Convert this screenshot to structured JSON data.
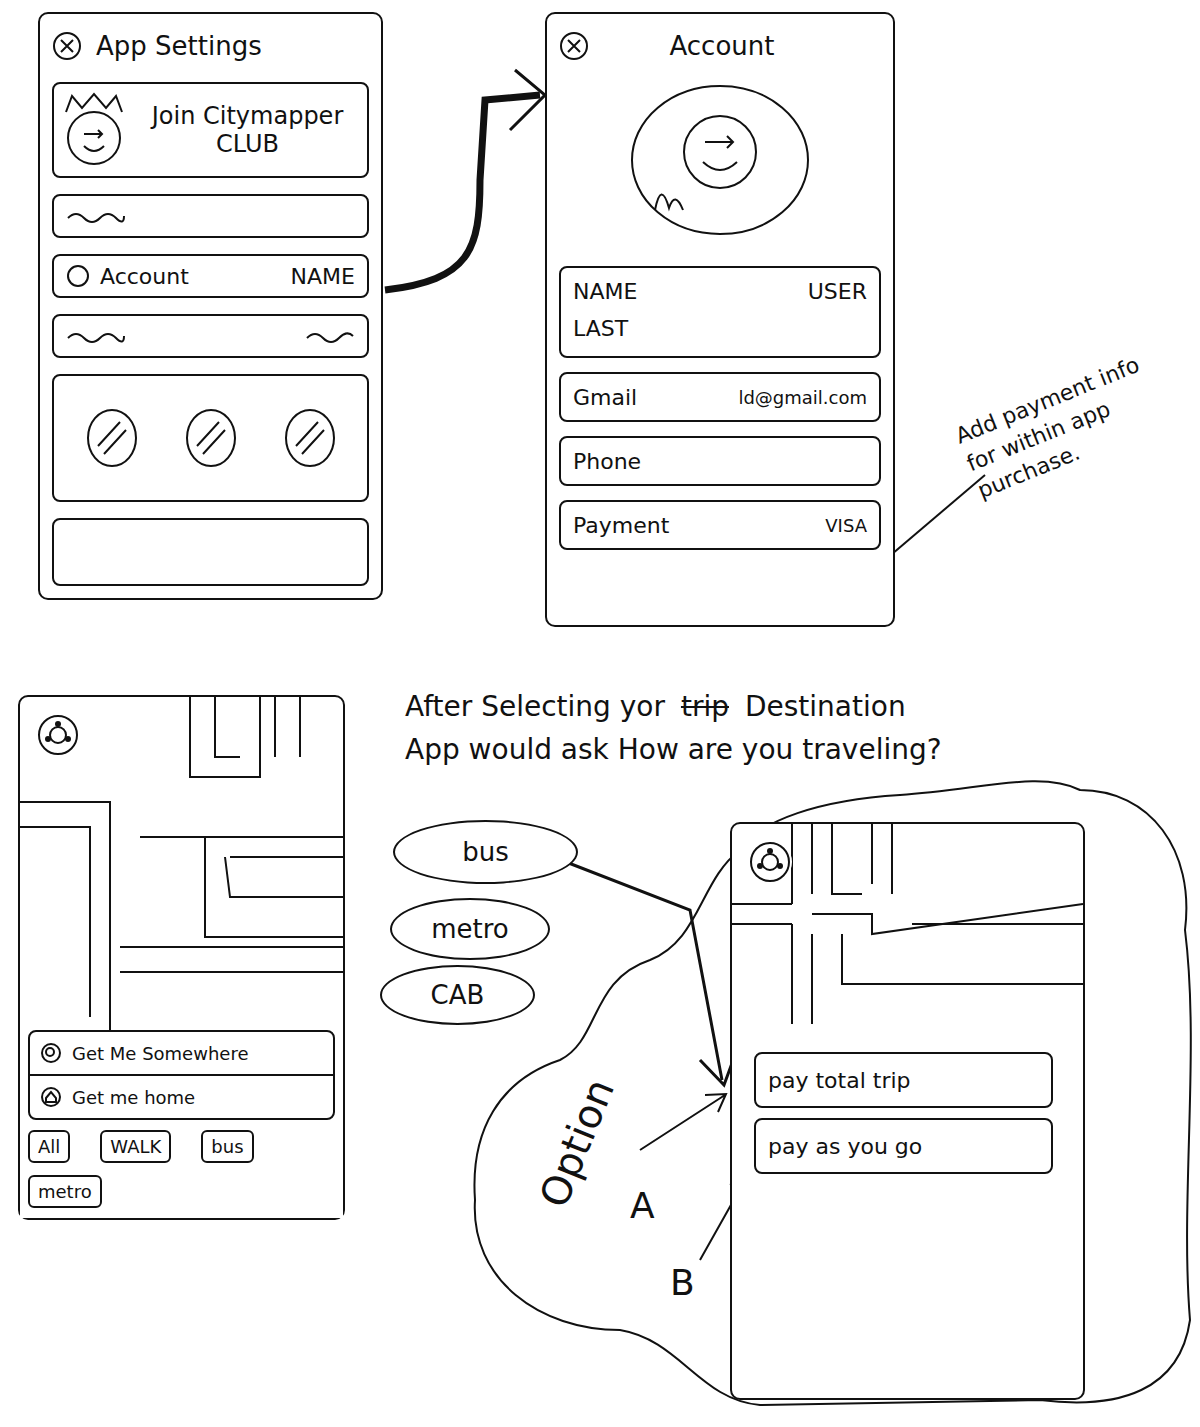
{
  "settings_screen": {
    "title": "App Settings",
    "club_banner": [
      "Join Citymapper",
      "CLUB"
    ],
    "rows": [
      {
        "kind": "squiggle"
      },
      {
        "kind": "account",
        "label": "Account",
        "value": "NAME"
      },
      {
        "kind": "squiggle-pair"
      },
      {
        "kind": "icons"
      },
      {
        "kind": "blank"
      }
    ]
  },
  "account_screen": {
    "title": "Account",
    "name_box": {
      "label": "NAME",
      "value": "USER",
      "last": "LAST"
    },
    "fields": [
      {
        "label": "Gmail",
        "value": "ld@gmail.com"
      },
      {
        "label": "Phone"
      },
      {
        "label": "Payment",
        "value": "VISA"
      }
    ]
  },
  "payment_note": "Add payment info for within app purchase.",
  "map_screen": {
    "search_items": [
      {
        "label": "Get Me Somewhere",
        "icon": "search"
      },
      {
        "label": "Get me home",
        "icon": "home"
      }
    ],
    "filters": [
      "All",
      "WALK",
      "bus",
      "metro"
    ]
  },
  "flow_note": {
    "parts": [
      {
        "text": "After Selecting yor",
        "struck": false
      },
      {
        "text": "trip",
        "struck": true
      },
      {
        "text": "Destination",
        "struck": false
      }
    ],
    "question": "App would ask How are you traveling?"
  },
  "travel_options": [
    "bus",
    "metro",
    "CAB"
  ],
  "payment_screen": {
    "options": [
      "pay total trip",
      "pay as you go"
    ]
  },
  "option_callout": {
    "title": "Option",
    "labels": [
      "A",
      "B"
    ]
  }
}
